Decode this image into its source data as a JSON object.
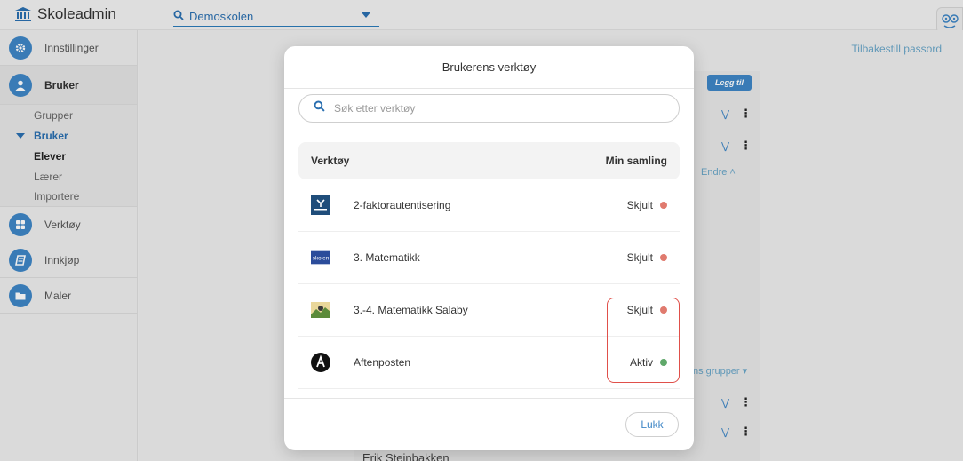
{
  "app": {
    "title": "Skoleadmin"
  },
  "school_select": {
    "value": "Demoskolen"
  },
  "sidebar": {
    "items": [
      {
        "label": "Innstillinger",
        "icon": "gear-icon"
      },
      {
        "label": "Bruker",
        "icon": "user-icon"
      },
      {
        "label": "Verktøy",
        "icon": "grid-icon"
      },
      {
        "label": "Innkjøp",
        "icon": "book-icon"
      },
      {
        "label": "Maler",
        "icon": "folder-icon"
      }
    ],
    "sub": {
      "grupper": "Grupper",
      "bruker": "Bruker",
      "elever": "Elever",
      "laerer": "Lærer",
      "importere": "Importere"
    }
  },
  "background": {
    "reset_password": "Tilbakestill passord",
    "add_button": "Legg til",
    "edit": "Endre",
    "groups": "ns grupper",
    "bottom_name": "Erik Steinbakken"
  },
  "modal": {
    "title": "Brukerens verktøy",
    "search_placeholder": "Søk etter verktøy",
    "columns": {
      "tool": "Verktøy",
      "collection": "Min samling"
    },
    "rows": [
      {
        "name": "2-faktorautentisering",
        "status": "Skjult",
        "status_color": "#e07a6e"
      },
      {
        "name": "3. Matematikk",
        "status": "Skjult",
        "status_color": "#e07a6e"
      },
      {
        "name": "3.-4. Matematikk Salaby",
        "status": "Skjult",
        "status_color": "#e07a6e"
      },
      {
        "name": "Aftenposten",
        "status": "Aktiv",
        "status_color": "#5fa86a"
      }
    ],
    "close_label": "Lukk"
  },
  "colors": {
    "accent": "#3e86c6",
    "highlight": "#e0504a"
  }
}
